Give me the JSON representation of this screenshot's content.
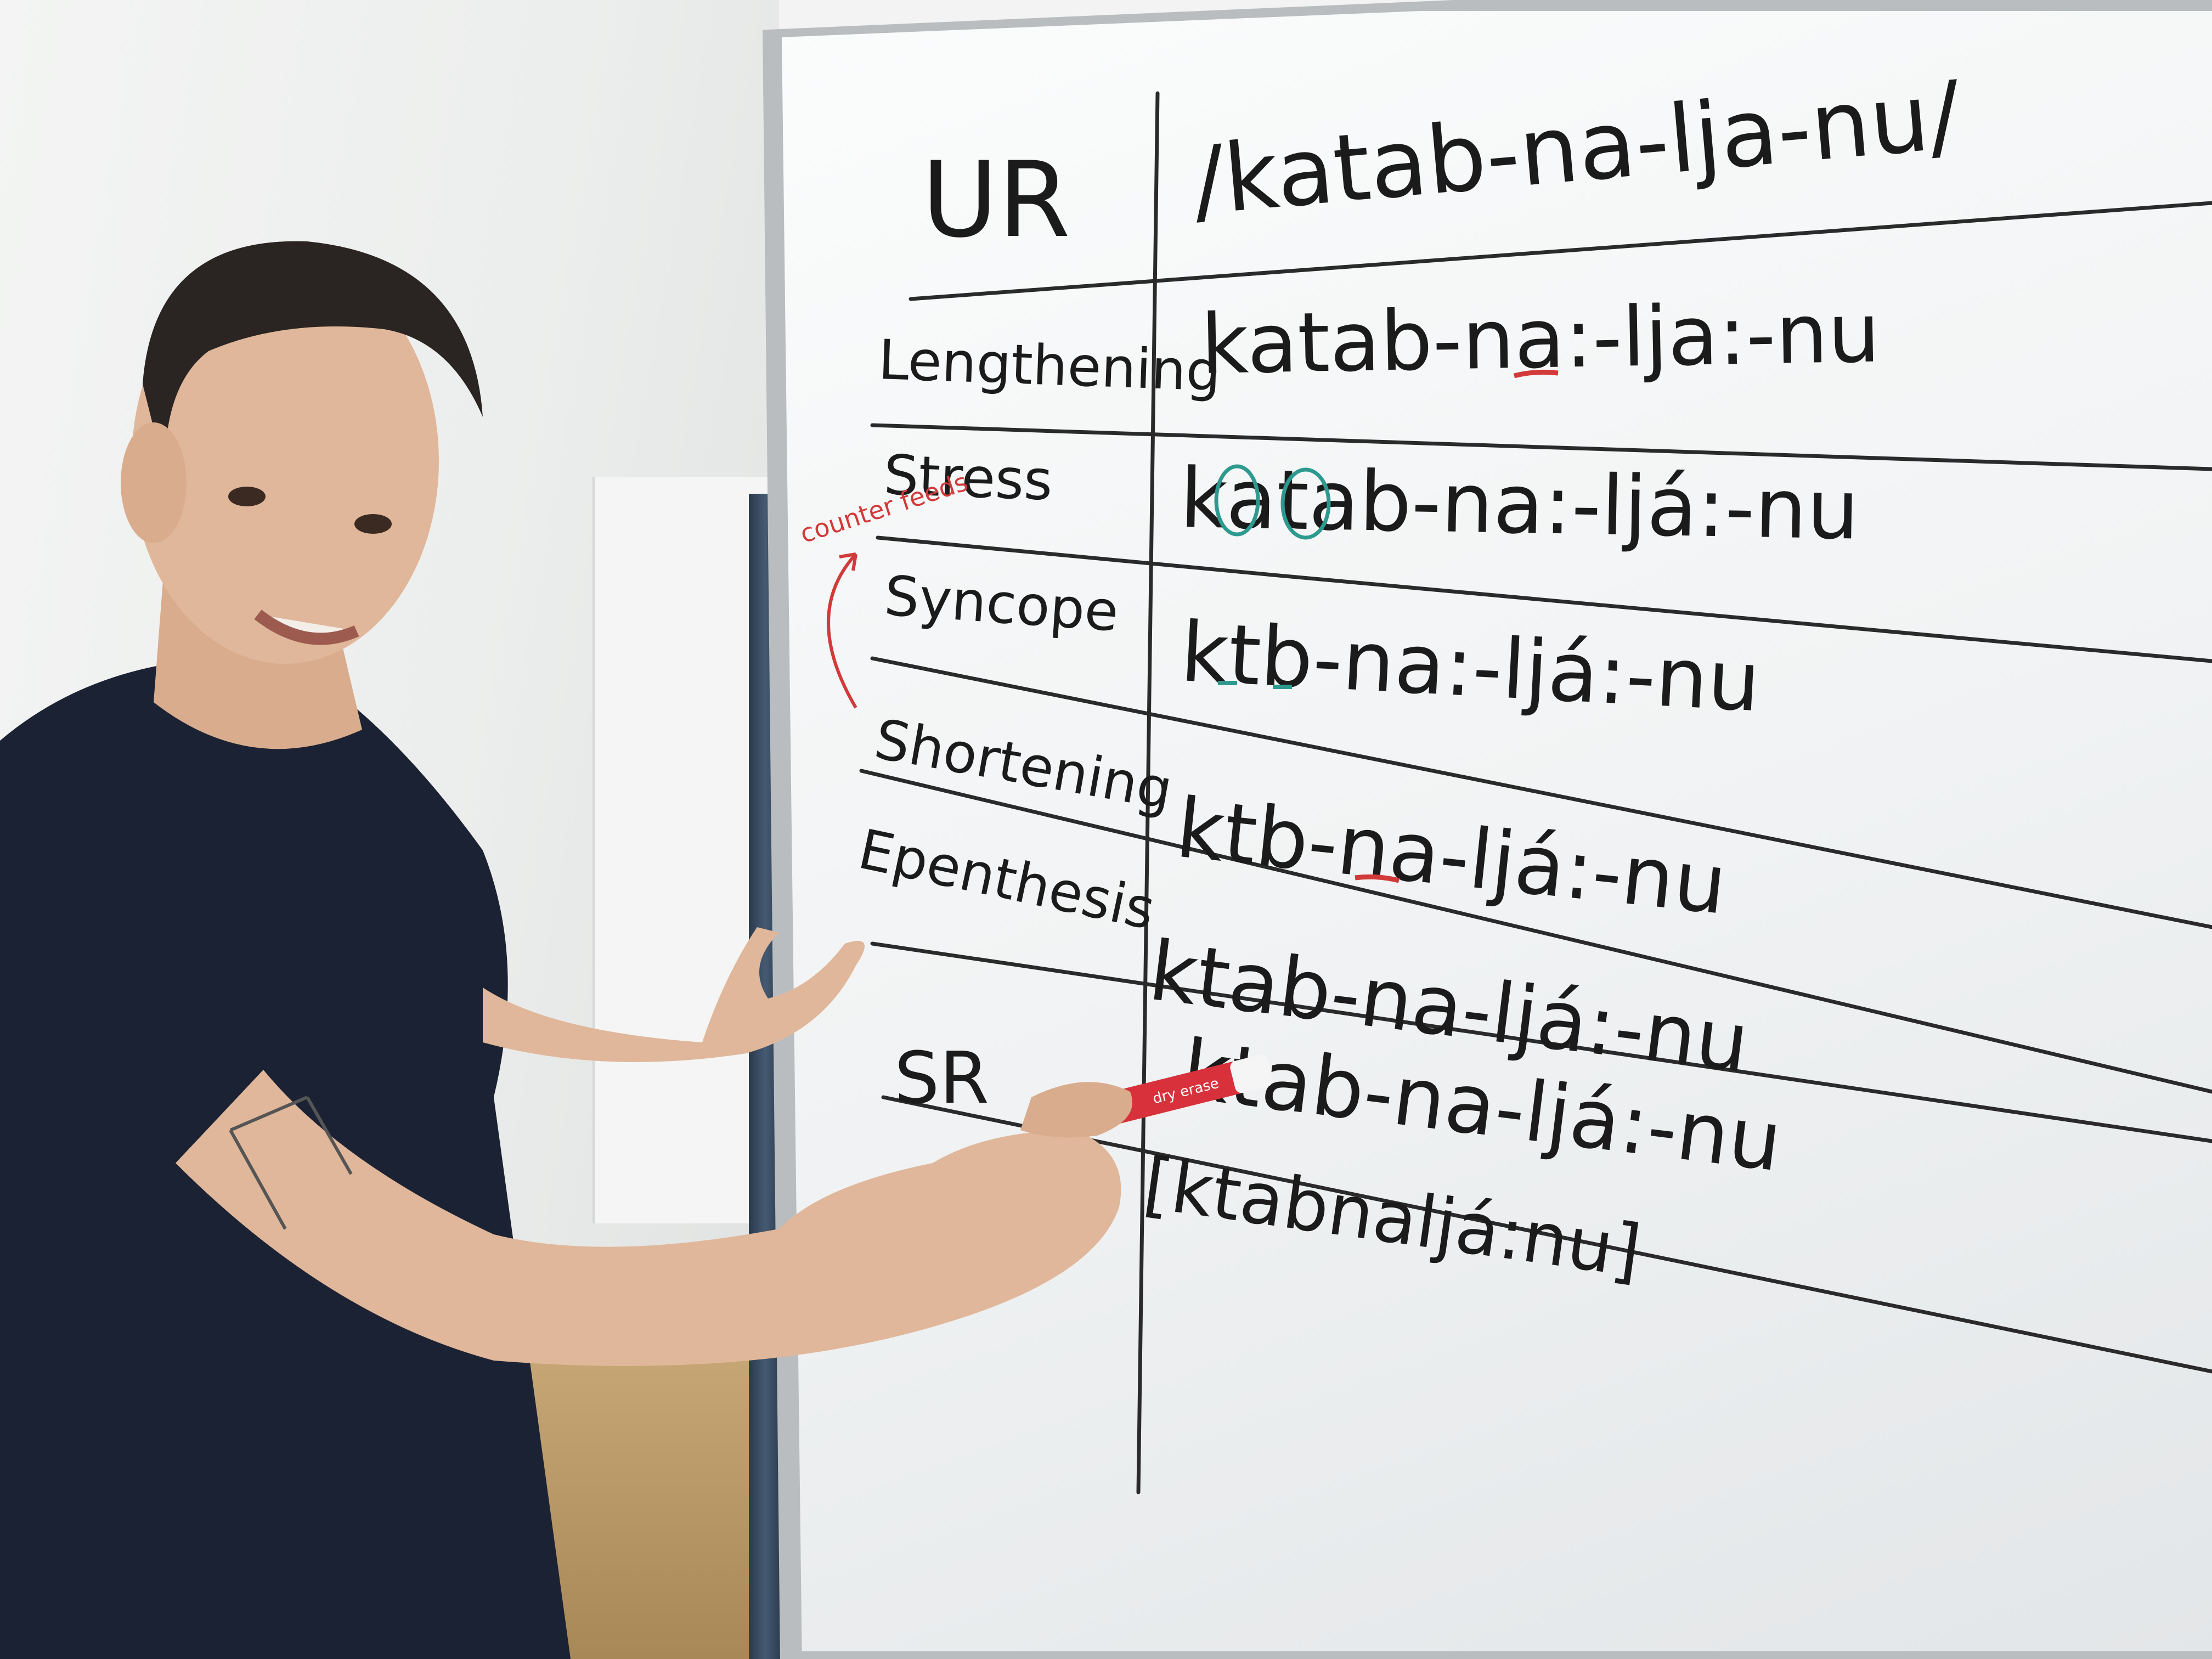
{
  "whiteboard": {
    "ur_label": "UR",
    "ur_form": "/katab-na-lja-nu/",
    "rows": [
      {
        "rule": "Lengthening",
        "form": "katab-na:-lja:-nu"
      },
      {
        "rule": "Stress",
        "form": "katab-na:-ljá:-nu"
      },
      {
        "rule": "Syncope",
        "form": "ktb-na:-ljá:-nu"
      },
      {
        "rule": "Shortening",
        "form": "ktb-na-ljá:-nu"
      },
      {
        "rule": "Epenthesis",
        "form": "ktab-na-ljá:-nu"
      },
      {
        "rule": "SR",
        "form": "ktab-na-ljá:-nu"
      }
    ],
    "sr_bracket_form": "[ktabnaljá:nu]",
    "annotation": "counter feeds"
  },
  "marker_label": "dry erase",
  "colors": {
    "ink": "#1b1b1b",
    "red_marker": "#d23a3a",
    "teal_marker": "#2e9a8f",
    "shirt": "#1b2233",
    "skin": "#e0b79a"
  }
}
